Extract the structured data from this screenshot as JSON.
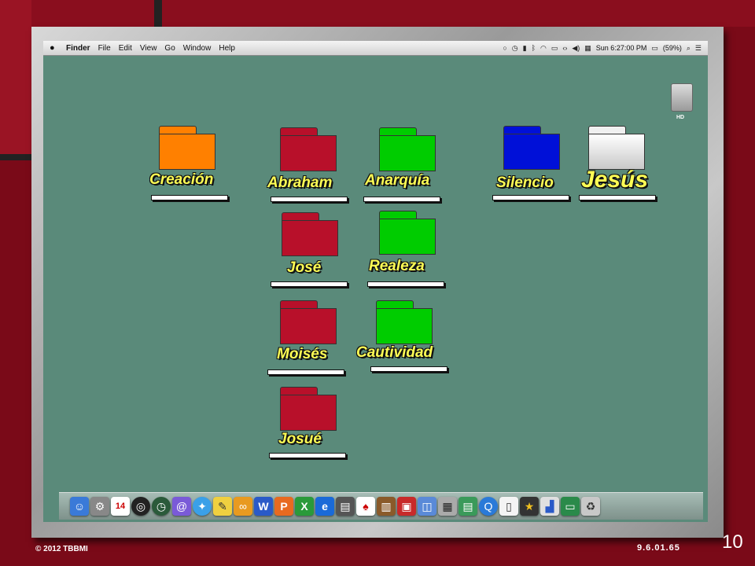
{
  "menubar": {
    "apple": "",
    "menus": [
      "Finder",
      "File",
      "Edit",
      "View",
      "Go",
      "Window",
      "Help"
    ],
    "clock": "Sun 6:27:00 PM",
    "battery": "(59%)"
  },
  "hd_label": "HD",
  "folders": [
    {
      "label": "Creación",
      "color": "#ff8000"
    },
    {
      "label": "Abraham",
      "color": "#b8102a"
    },
    {
      "label": "Anarquía",
      "color": "#00cc00"
    },
    {
      "label": "Silencio",
      "color": "#0010d8"
    },
    {
      "label": "Jesús",
      "color": "#f0f0f0"
    },
    {
      "label": "José",
      "color": "#b8102a"
    },
    {
      "label": "Realeza",
      "color": "#00cc00"
    },
    {
      "label": "Moisés",
      "color": "#b8102a"
    },
    {
      "label": "Cautividad",
      "color": "#00cc00"
    },
    {
      "label": "Josué",
      "color": "#b8102a"
    }
  ],
  "dock": {
    "icons": [
      "finder-icon",
      "system-prefs-icon",
      "calendar-icon",
      "dashboard-icon",
      "time-machine-icon",
      "mail-icon",
      "safari-icon",
      "notes-icon",
      "link-icon",
      "word-icon",
      "powerpoint-icon",
      "excel-icon",
      "internet-explorer-icon",
      "printer-icon",
      "cards-icon",
      "dictionary-icon",
      "photo-booth-icon",
      "preview-icon",
      "calculator-icon",
      "sheets-icon",
      "quicktime-icon",
      "textedit-icon",
      "imovie-icon",
      "charts-icon",
      "screen-icon",
      "trash-icon"
    ],
    "calendar_day": "14"
  },
  "footer": {
    "copyright": "© 2012 TBBMI",
    "code": "9.6.01.65",
    "page": "10"
  }
}
